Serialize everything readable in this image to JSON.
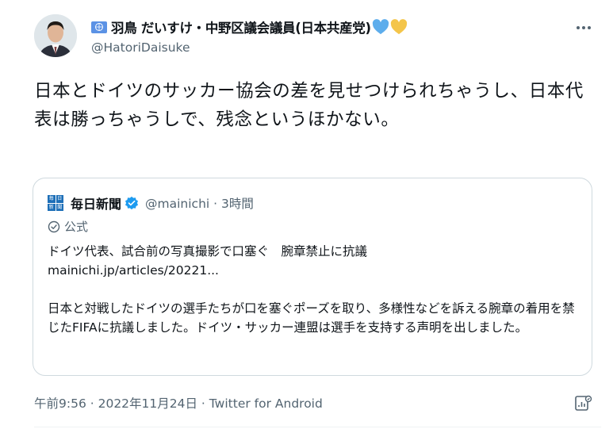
{
  "author": {
    "display_name": "羽鳥 だいすけ・中野区議会議員(日本共産党)",
    "handle": "@HatoriDaisuke",
    "badge_icon": "un-flag-icon",
    "heart_colors": [
      "#5dadec",
      "#f4c54a"
    ]
  },
  "tweet": {
    "text": "日本とドイツのサッカー協会の差を見せつけられちゃうし、日本代表は勝っちゃうしで、残念というほかない。"
  },
  "quote": {
    "logo_chars": [
      "毎",
      "日",
      "新",
      "聞"
    ],
    "name": "毎日新聞",
    "handle_time": "@mainichi · 3時間",
    "official_label": "公式",
    "line1": "ドイツ代表、試合前の写真撮影で口塞ぐ　腕章禁止に抗議",
    "link": "mainichi.jp/articles/20221...",
    "line3": "日本と対戦したドイツの選手たちが口を塞ぐポーズを取り、多様性などを訴える腕章の着用を禁じたFIFAに抗議しました。ドイツ・サッカー連盟は選手を支持する声明を出しました。"
  },
  "meta": {
    "time": "午前9:56",
    "sep1": " · ",
    "date": "2022年11月24日",
    "sep2": " · ",
    "client": "Twitter for Android"
  },
  "colors": {
    "accent": "#1d9bf0",
    "muted": "#536471",
    "border": "#cfd9de"
  }
}
